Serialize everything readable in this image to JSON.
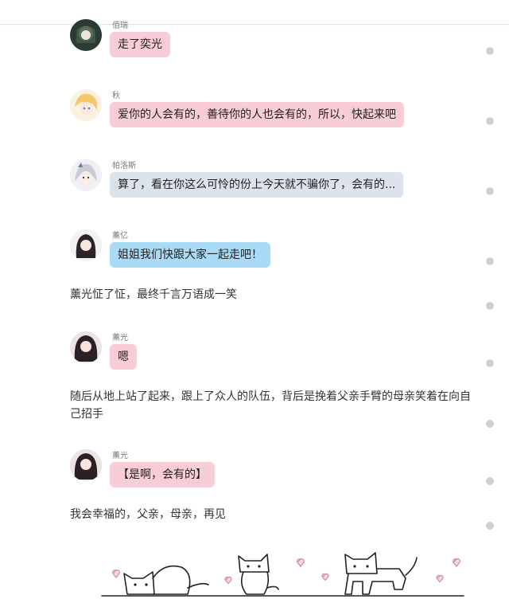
{
  "messages": [
    {
      "name": "佰瑞",
      "text": "走了奕光"
    },
    {
      "name": "秋",
      "text": "爱你的人会有的，善待你的人也会有的，所以，快起来吧"
    },
    {
      "name": "帕洛斯",
      "text": "算了，看在你这么可怜的份上今天就不骗你了，会有的..."
    },
    {
      "name": "薰亿",
      "text": "姐姐我们快跟大家一起走吧！"
    },
    {
      "name": "薰光",
      "text": "嗯"
    },
    {
      "name": "薰光",
      "text": "【是啊，会有的】"
    }
  ],
  "narration": [
    "薰光怔了怔，最终千言万语成一笑",
    "随后从地上站了起来，跟上了众人的队伍，背后是挽着父亲手臂的母亲笑着在向自己招手",
    "我会幸福的，父亲，母亲，再见"
  ],
  "colors": {
    "bubble_pink": "#f9cdd7",
    "bubble_gray": "#dde3ec",
    "bubble_blue": "#a9dbf7",
    "heart": "#e8a7b6"
  },
  "illustration": {
    "icon": "cats-and-hearts-doodle"
  }
}
